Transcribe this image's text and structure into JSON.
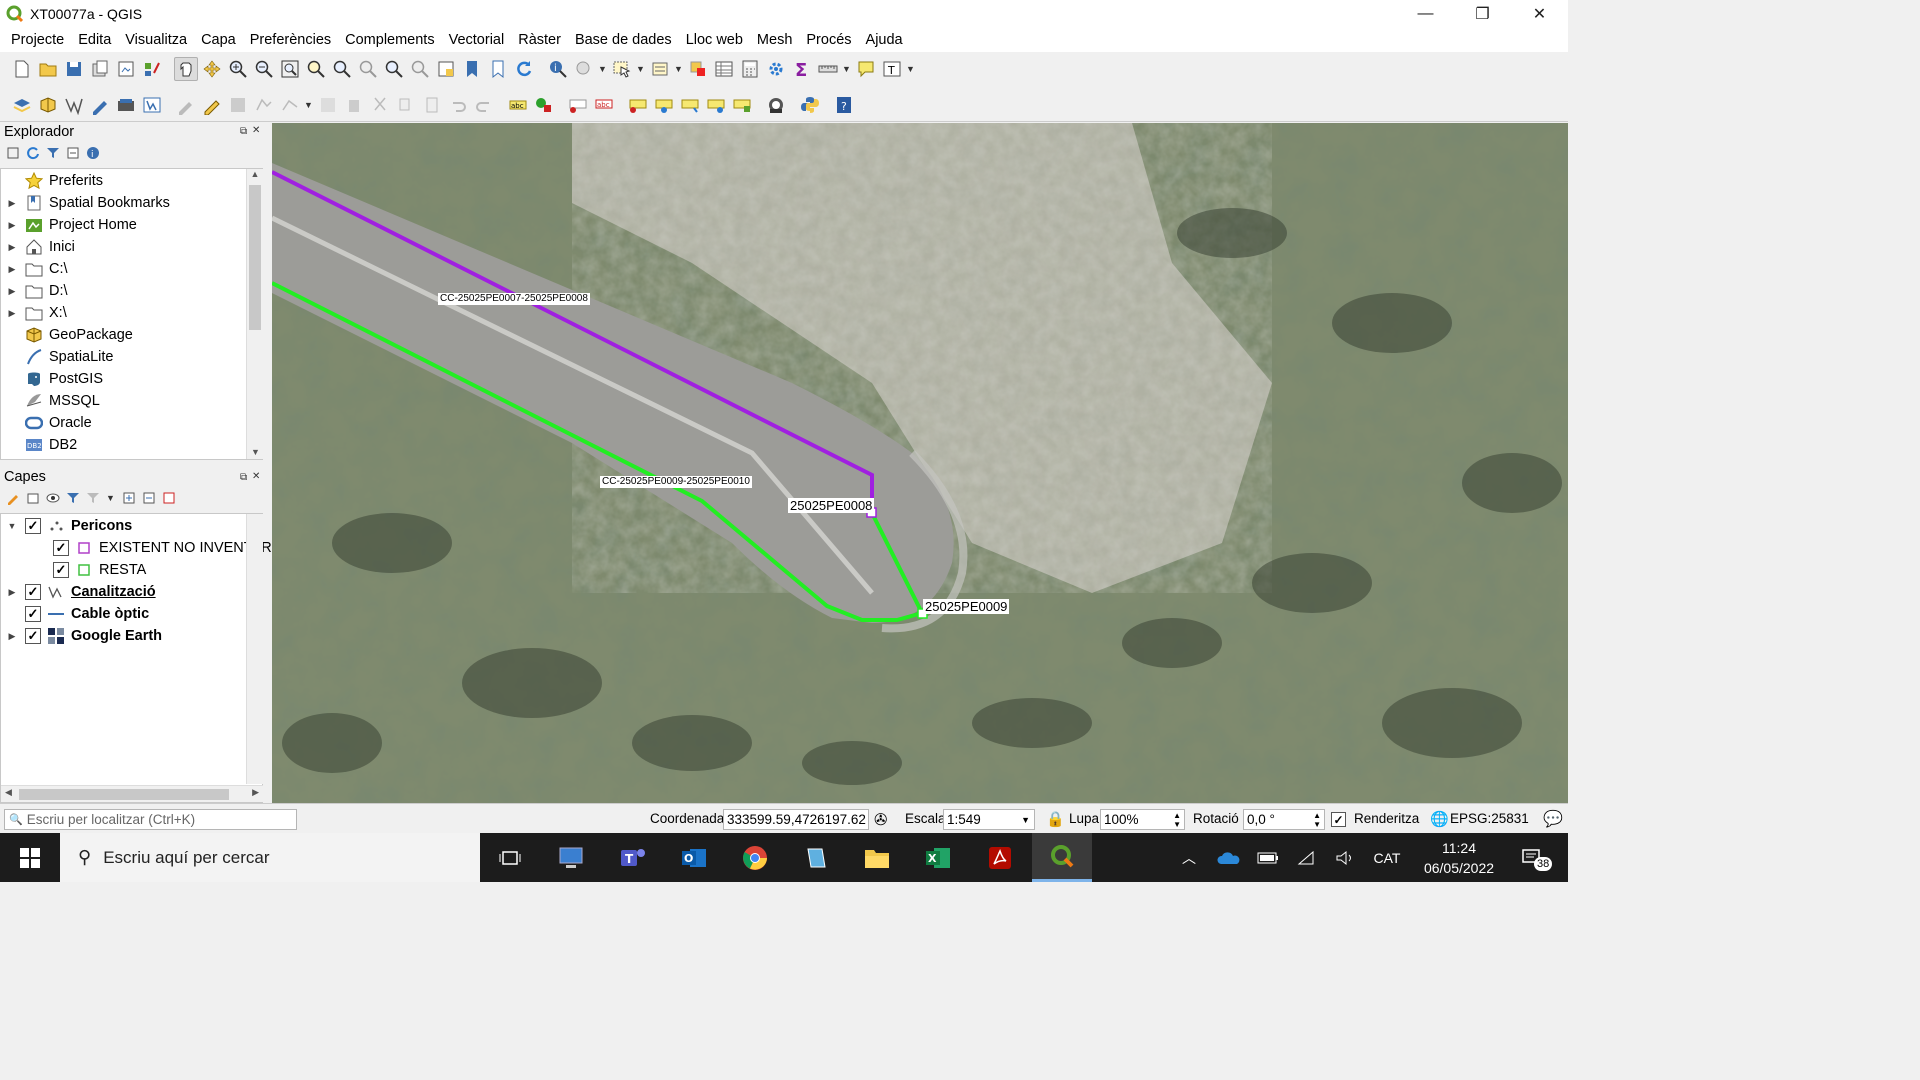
{
  "window": {
    "title": "XT00077a - QGIS",
    "controls": [
      "—",
      "❐",
      "✕"
    ]
  },
  "menu": [
    "Projecte",
    "Edita",
    "Visualitza",
    "Capa",
    "Preferències",
    "Complements",
    "Vectorial",
    "Ràster",
    "Base de dades",
    "Lloc web",
    "Mesh",
    "Procés",
    "Ajuda"
  ],
  "browser": {
    "title": "Explorador",
    "items": [
      {
        "label": "Preferits",
        "icon": "star-icon",
        "expandable": false
      },
      {
        "label": "Spatial Bookmarks",
        "icon": "bookmark-icon",
        "expandable": true
      },
      {
        "label": "Project Home",
        "icon": "project-home-icon",
        "expandable": true
      },
      {
        "label": "Inici",
        "icon": "home-icon",
        "expandable": true
      },
      {
        "label": "C:\\",
        "icon": "folder-icon",
        "expandable": true
      },
      {
        "label": "D:\\",
        "icon": "folder-icon",
        "expandable": true
      },
      {
        "label": "X:\\",
        "icon": "folder-icon",
        "expandable": true
      },
      {
        "label": "GeoPackage",
        "icon": "geopackage-icon",
        "expandable": false
      },
      {
        "label": "SpatiaLite",
        "icon": "spatialite-icon",
        "expandable": false
      },
      {
        "label": "PostGIS",
        "icon": "postgis-icon",
        "expandable": false
      },
      {
        "label": "MSSQL",
        "icon": "mssql-icon",
        "expandable": false
      },
      {
        "label": "Oracle",
        "icon": "oracle-icon",
        "expandable": false
      },
      {
        "label": "DB2",
        "icon": "db2-icon",
        "expandable": false
      }
    ]
  },
  "layers": {
    "title": "Capes",
    "items": [
      {
        "label": "Pericons",
        "checked": true,
        "bold": true,
        "underline": false,
        "expanded": true
      },
      {
        "label": "EXISTENT NO INVENTARI",
        "checked": true,
        "sub": true,
        "symbol_color": "#b040c8"
      },
      {
        "label": "RESTA",
        "checked": true,
        "sub": true,
        "symbol_color": "#40c040"
      },
      {
        "label": "Canalització",
        "checked": true,
        "bold": true,
        "underline": true,
        "expandable": true
      },
      {
        "label": "Cable òptic",
        "checked": true,
        "bold": true,
        "underline": false
      },
      {
        "label": "Google Earth",
        "checked": true,
        "bold": true,
        "underline": false,
        "expandable": true
      }
    ]
  },
  "map": {
    "labels": {
      "conduit_purple": "CC-25025PE0007-25025PE0008",
      "conduit_green": "CC-25025PE0009-25025PE0010",
      "node_a": "25025PE0008",
      "node_b": "25025PE0009"
    },
    "colors": {
      "purple": "#a020e0",
      "green": "#22ee22"
    }
  },
  "statusbar": {
    "locator_placeholder": "Escriu per localitzar (Ctrl+K)",
    "coord_label": "Coordenada",
    "coord_value": "333599.59,4726197.62",
    "scale_label": "Escala",
    "scale_value": "1:549",
    "magnifier_label": "Lupa",
    "magnifier_value": "100%",
    "rotation_label": "Rotació",
    "rotation_value": "0,0 °",
    "render_label": "Renderitza",
    "crs": "EPSG:25831"
  },
  "taskbar": {
    "search_text": "Escriu aquí per cercar",
    "language": "CAT",
    "time": "11:24",
    "date": "06/05/2022",
    "notification_count": "38"
  }
}
